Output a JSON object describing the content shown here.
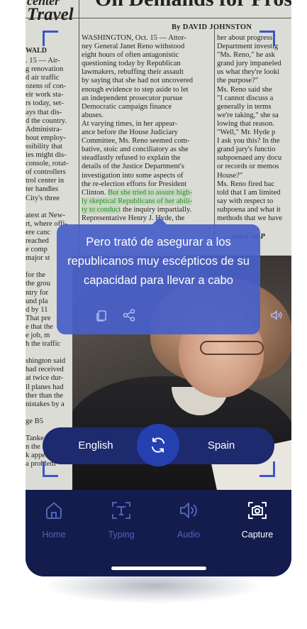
{
  "newspaper": {
    "headline_left": "Travel",
    "headline_left_top": "center",
    "headline_main": "On Demands for Pros",
    "byline": "By DAVID JOHNSTON",
    "left_author": "WALD",
    "col_left": [
      ". 15 — Air-",
      "g renovation",
      "d air traffic",
      "ozens of con-",
      "eir work sta-",
      "rs today, set-",
      "ays that dis-",
      "d the country.",
      "Administra-",
      "bout employ-",
      "ssibility that",
      "ies might dis-",
      "console, rotat-",
      "of controllers",
      "trol center in",
      "ter handles",
      "City's three",
      "",
      "atest at New-",
      "rt, where offi-",
      "ere canc",
      "reached",
      "e comp",
      "major st",
      "",
      "for the",
      "the grou",
      "ntry for",
      "und pla",
      "d by 11",
      "That pre",
      "e that the",
      "e job, m",
      "h the traffic",
      "",
      "shington said",
      "had received",
      "at twice dur-",
      "ll planes had",
      "ther than the",
      "nistakes by a",
      "",
      "ge B5",
      "",
      "Tanke",
      "n the closed",
      "k appears to",
      "a problem"
    ],
    "col_mid_1": "WASHINGTON, Oct. 15 — Attor-",
    "col_mid": [
      "ney General Janet Reno withstood",
      "eight hours of often antagonistic",
      "questioning today by Republican",
      "lawmakers, rebuffing their assault",
      "by saying that she had not uncovered",
      "enough evidence to step aside to let",
      "an independent prosecutor pursue",
      "Democratic campaign finance",
      "abuses.",
      "At varying times, in her appear-",
      "ance before the House Judiciary",
      "Committee, Ms. Reno seemed com-",
      "bative, stoic and conciliatory as she",
      "steadfastly refused to explain the",
      "details of the Justice Department's",
      "investigation into some aspects of",
      "the re-election efforts for President"
    ],
    "col_mid_hl_a": "Clinton. ",
    "col_mid_hl_b": "But she tried to assure high-",
    "col_mid_hl_c": "ly skeptical Republicans of her abili-",
    "col_mid_hl_d": "ty to conduct",
    "col_mid_hl_e": " the inquiry impartially.",
    "col_mid_last": "Representative Henry J. Hyde, the",
    "col_right": [
      "her about progress",
      "Department investig",
      "\"Ms. Reno,\" he ask",
      "grand jury impaneled",
      "us what they're looki",
      "the purpose?\"",
      "Ms. Reno said she",
      "\"I cannot discuss a",
      "generally in terms",
      "we're taking,\" she sa",
      "lowing that reason.",
      "\"Well,\" Mr. Hyde p",
      "I ask you this? In the",
      "grand jury's functio",
      "subpoenaed any docu",
      "or records or memos",
      "House?\"",
      "Ms. Reno fired bac",
      "told that I am limited",
      "say with respect to",
      "subpoena and what it",
      "methods that we have"
    ],
    "continued": "inued on P"
  },
  "translation": {
    "text": "Pero trató de asegurar a los republicanos muy escépticos de su capacidad para llevar a cabo"
  },
  "language": {
    "source": "English",
    "target": "Spain"
  },
  "nav": {
    "items": [
      {
        "label": "Home",
        "icon": "home-icon",
        "active": false
      },
      {
        "label": "Typing",
        "icon": "typing-icon",
        "active": false
      },
      {
        "label": "Audio",
        "icon": "speaker-icon",
        "active": false
      },
      {
        "label": "Capture",
        "icon": "camera-scan-icon",
        "active": true
      }
    ]
  },
  "colors": {
    "accent": "#2541b0",
    "bubble": "#4860c8",
    "nav_bg": "#141c4e",
    "nav_inactive": "#5064b6",
    "highlight_text": "#2c8a2c"
  }
}
